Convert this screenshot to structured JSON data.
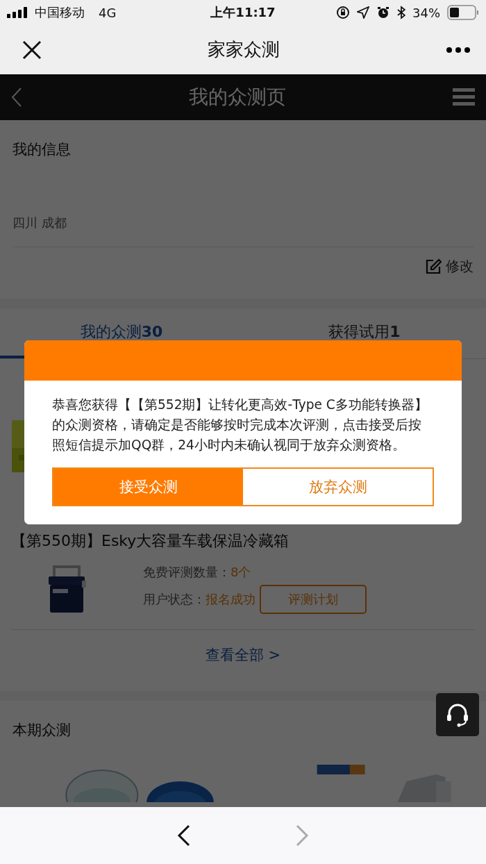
{
  "status_bar": {
    "carrier": "中国移动",
    "network": "4G",
    "time": "上午11:17",
    "battery": "34%"
  },
  "nav": {
    "title": "家家众测"
  },
  "header": {
    "title": "我的众测页"
  },
  "my_info": {
    "title": "我的信息",
    "location": "四川 成都",
    "edit": "修改"
  },
  "tabs": [
    {
      "label": "我的众测**30**",
      "selected": true
    },
    {
      "label": "获得试用**1**",
      "selected": false
    }
  ],
  "trials": [
    {
      "title": "【第550期】Esky大容量车载保温冷藏箱",
      "quantity_label": "免费评测数量：",
      "quantity": "8个",
      "status_label": "用户状态：",
      "status": "报名成功",
      "plan_button": "评测计划"
    }
  ],
  "view_all": "查看全部 >",
  "current": {
    "title": "本期众测"
  },
  "dialog": {
    "message": "恭喜您获得【【第552期】让转化更高效-Type C多功能转换器】的众测资格，请确定是否能够按时完成本次评测，点击接受后按照短信提示加QQ群，24小时内未确认视同于放弃众测资格。",
    "accept": "接受众测",
    "decline": "放弃众测"
  },
  "bottom_bar": {
    "back_disabled": false,
    "forward_disabled": true
  }
}
